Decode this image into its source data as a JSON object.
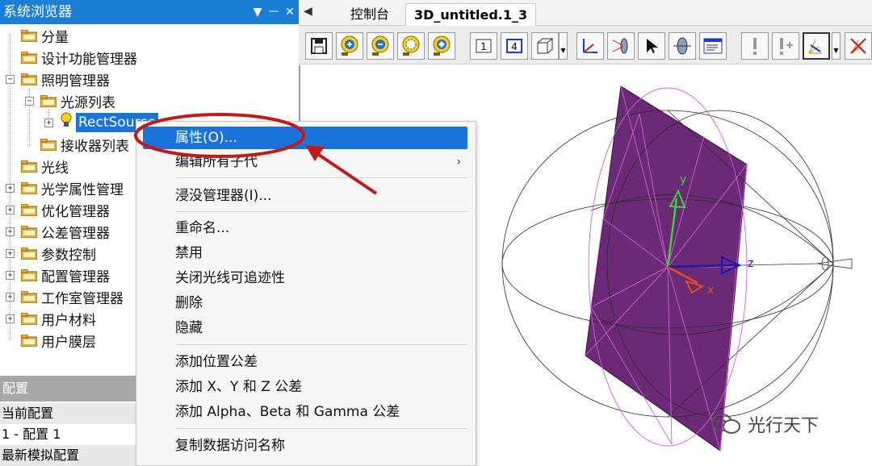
{
  "browser": {
    "title": "系统浏览器",
    "title_buttons": [
      "▼",
      "ᅳ",
      "✕"
    ]
  },
  "tree": {
    "items": [
      {
        "label": "分量"
      },
      {
        "label": "设计功能管理器"
      },
      {
        "label": "照明管理器"
      },
      {
        "label": "光源列表"
      },
      {
        "label": "RectSource"
      },
      {
        "label": "接收器列表"
      },
      {
        "label": "光线"
      },
      {
        "label": "光学属性管理"
      },
      {
        "label": "优化管理器"
      },
      {
        "label": "公差管理器"
      },
      {
        "label": "参数控制"
      },
      {
        "label": "配置管理器"
      },
      {
        "label": "工作室管理器"
      },
      {
        "label": "用户材料"
      },
      {
        "label": "用户膜层"
      }
    ]
  },
  "config": {
    "header": "配置",
    "current_label": "当前配置",
    "current_value": "1 - 配置 1",
    "latest_label": "最新模拟配置"
  },
  "tabs": {
    "arrow": "◀",
    "items": [
      {
        "label": "控制台"
      },
      {
        "label": "3D_untitled.1_3"
      }
    ]
  },
  "toolbar": {
    "number_1": "1",
    "number_4": "4"
  },
  "scene": {
    "axis_y": "y",
    "axis_z": "z",
    "axis_x": "x",
    "plane_color": "#6b2a75",
    "axis_y_color": "#3fd43f",
    "axis_z_color": "#1010d0",
    "axis_x_color": "#e05020"
  },
  "context_menu": {
    "items": [
      {
        "label": "属性(O)..."
      },
      {
        "label": "编辑所有子代"
      },
      {
        "label": "浸没管理器(I)..."
      },
      {
        "label": "重命名..."
      },
      {
        "label": "禁用"
      },
      {
        "label": "关闭光线可追迹性"
      },
      {
        "label": "删除"
      },
      {
        "label": "隐藏"
      },
      {
        "label": "添加位置公差"
      },
      {
        "label": "添加 X、Y 和 Z 公差"
      },
      {
        "label": "添加 Alpha、Beta 和 Gamma 公差"
      },
      {
        "label": "复制数据访问名称"
      }
    ],
    "submenu_arrow": "›"
  },
  "watermark": {
    "text": "光行天下"
  },
  "colors": {
    "title_bar": "#1c7fd6",
    "selection": "#1a73d8",
    "annotation": "#c01a1a"
  }
}
